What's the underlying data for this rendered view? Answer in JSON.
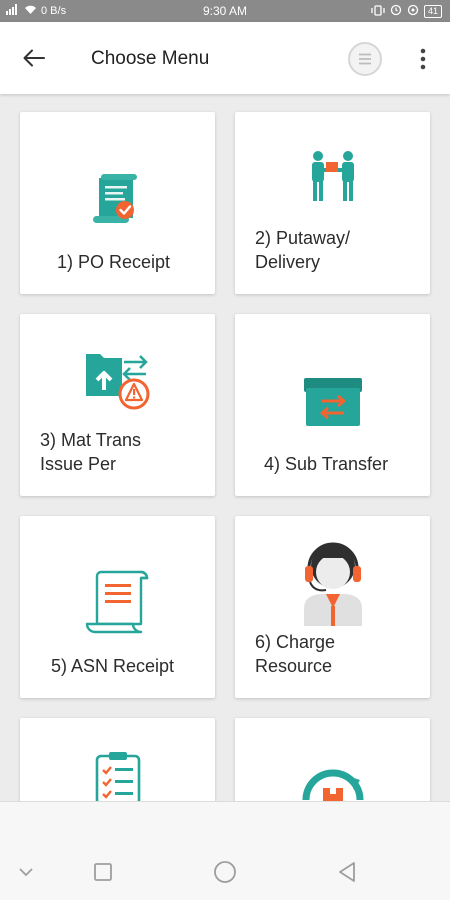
{
  "status_bar": {
    "network_speed": "0 B/s",
    "time": "9:30 AM",
    "battery": "41"
  },
  "app_bar": {
    "title": "Choose Menu"
  },
  "menu": {
    "items": [
      {
        "line1": "1) PO Receipt",
        "line2": "",
        "icon": "po-receipt-icon"
      },
      {
        "line1": "2) Putaway/",
        "line2": "Delivery",
        "icon": "putaway-delivery-icon"
      },
      {
        "line1": "3) Mat Trans",
        "line2": "Issue Per",
        "icon": "mat-trans-issue-icon"
      },
      {
        "line1": "4) Sub Transfer",
        "line2": "",
        "icon": "sub-transfer-icon"
      },
      {
        "line1": "5) ASN Receipt",
        "line2": "",
        "icon": "asn-receipt-icon"
      },
      {
        "line1": "6) Charge",
        "line2": "Resource",
        "icon": "charge-resource-icon"
      }
    ]
  },
  "colors": {
    "teal": "#26a69a",
    "orange": "#f26430",
    "background": "#ececec"
  }
}
